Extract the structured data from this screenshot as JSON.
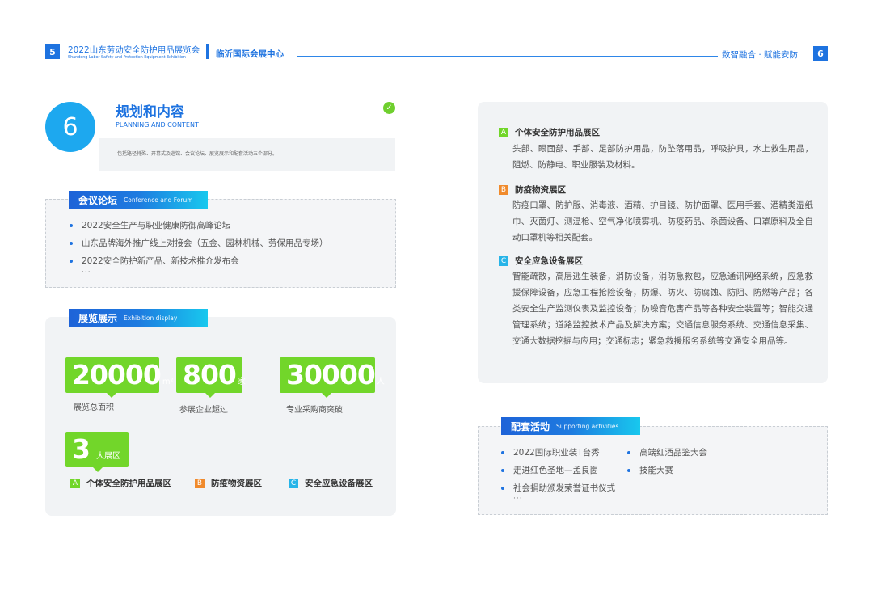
{
  "header": {
    "left_page_number": "5",
    "exhibition_title": "2022山东劳动安全防护用品展览会",
    "exhibition_subtitle": "Shandong Labor Safety and Protection Equipment Exhibition",
    "venue": "临沂国际会展中心",
    "slogan": "数智融合 · 赋能安防",
    "right_page_number": "6"
  },
  "section": {
    "number": "6",
    "title": "规划和内容",
    "title_en": "PLANNING AND CONTENT",
    "check_icon": "check-circle-icon",
    "intro": "包括路径特殊、开幕式及巡馆、会议论坛、展览展示和配套活动五个部分。"
  },
  "forum": {
    "tag_cn": "会议论坛",
    "tag_en": "Conference and Forum",
    "items": [
      "2022安全生产与职业健康防御高峰论坛",
      "山东品牌海外推广线上对接会（五金、园林机械、劳保用品专场）",
      "2022安全防护新产品、新技术推介发布会"
    ],
    "ellipsis": "···"
  },
  "exhibition": {
    "tag_cn": "展览展示",
    "tag_en": "Exhibition display",
    "stats": [
      {
        "value": "20000",
        "unit": "m²",
        "label": "展览总面积"
      },
      {
        "value": "800",
        "unit": "家",
        "label": "参展企业超过"
      },
      {
        "value": "30000",
        "unit": "人",
        "label": "专业采购商突破"
      }
    ],
    "zones_count": {
      "value": "3",
      "unit": "大展区"
    },
    "zones": [
      {
        "letter": "A",
        "name": "个体安全防护用品展区"
      },
      {
        "letter": "B",
        "name": "防疫物资展区"
      },
      {
        "letter": "C",
        "name": "安全应急设备展区"
      }
    ]
  },
  "areas": [
    {
      "letter": "A",
      "title": "个体安全防护用品展区",
      "body": "头部、眼面部、手部、足部防护用品，防坠落用品，呼吸护具，水上救生用品，阻燃、防静电、职业服装及材料。"
    },
    {
      "letter": "B",
      "title": "防疫物资展区",
      "body": "防疫口罩、防护服、消毒液、酒精、护目镜、防护面罩、医用手套、酒精类湿纸巾、灭菌灯、测温枪、空气净化喷雾机、防疫药品、杀菌设备、口罩原料及全自动口罩机等相关配套。"
    },
    {
      "letter": "C",
      "title": "安全应急设备展区",
      "body": "智能疏散，高层逃生装备，消防设备，消防急救包，应急通讯网络系统，应急救援保障设备，应急工程抢险设备，防爆、防火、防腐蚀、防阻、防燃等产品；各类安全生产监测仪表及监控设备；防噪音危害产品等各种安全装置等；智能交通管理系统；道路监控技术产品及解决方案；交通信息服务系统、交通信息采集、交通大数据挖掘与应用；交通标志；紧急救援服务系统等交通安全用品等。"
    }
  ],
  "support": {
    "tag_cn": "配套活动",
    "tag_en": "Supporting activities",
    "left_items": [
      "2022国际职业装T台秀",
      "走进红色圣地—孟良崮",
      "社会捐助颁发荣誉证书仪式"
    ],
    "right_items": [
      "高端红酒品鉴大会",
      "技能大赛"
    ],
    "ellipsis": "···"
  }
}
